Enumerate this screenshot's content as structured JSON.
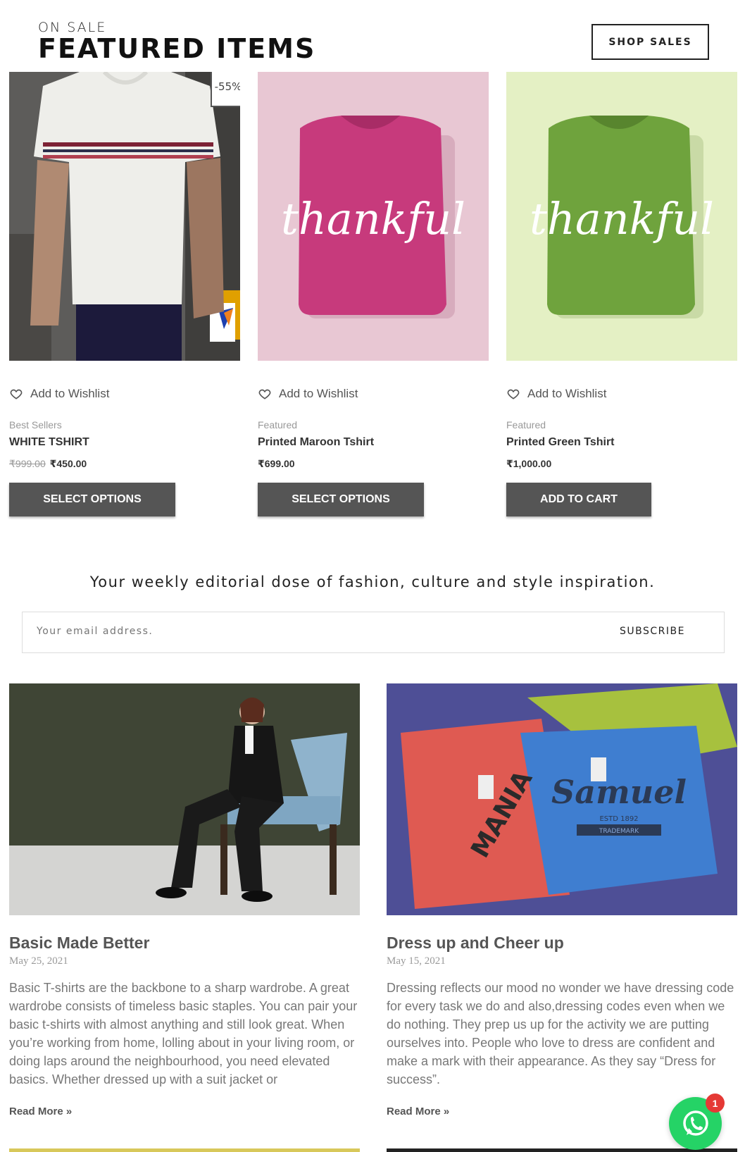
{
  "section": {
    "kicker": "ON SALE",
    "headline": "FEATURED ITEMS",
    "shop_button": "SHOP SALES"
  },
  "products": [
    {
      "badge": "-55%",
      "wishlist": "Add to Wishlist",
      "category": "Best Sellers",
      "name": "WHITE TSHIRT",
      "old_price": "₹999.00",
      "price": "₹450.00",
      "cta": "SELECT OPTIONS",
      "bg": "#6b6a68"
    },
    {
      "wishlist": "Add to Wishlist",
      "category": "Featured",
      "name": "Printed Maroon Tshirt",
      "price": "₹699.00",
      "cta": "SELECT OPTIONS",
      "bg": "#e8c7d3",
      "shirt_color": "#c73a7c",
      "print_text": "thankful"
    },
    {
      "wishlist": "Add to Wishlist",
      "category": "Featured",
      "name": "Printed Green Tshirt",
      "price": "₹1,000.00",
      "cta": "ADD TO CART",
      "bg": "#e4f0c4",
      "shirt_color": "#6fa33d",
      "print_text": "thankful"
    }
  ],
  "newsletter": {
    "tagline": "Your weekly editorial dose of fashion, culture and style inspiration.",
    "placeholder": "Your email address.",
    "subscribe": "SUBSCRIBE"
  },
  "posts": [
    {
      "title": "Basic Made Better",
      "date": "May 25, 2021",
      "excerpt": "Basic T-shirts  are the backbone to a sharp wardrobe. A great wardrobe consists of timeless basic staples.  You can pair your basic t-shirts with almost anything and still look great. When you’re working from home, lolling about in your living room, or doing laps around the neighbourhood, you need elevated basics. Whether dressed up with a suit jacket or",
      "read_more": "Read More »"
    },
    {
      "title": "Dress up and Cheer up",
      "date": "May 15, 2021",
      "excerpt": "Dressing reflects our mood no wonder we have dressing code for every task we do and also,dressing codes even when we do nothing. They prep us up for the activity we are putting ourselves into. People who love to dress are confident and make a mark with their appearance. As they say “Dress for success”.",
      "read_more": "Read More »"
    }
  ],
  "post2_print": {
    "brand": "Samuel",
    "estd": "ESTD 1892",
    "trademark": "TRADEMARK",
    "red_text": "MANIA"
  },
  "whatsapp": {
    "badge_count": "1",
    "icon": "whatsapp-icon"
  }
}
